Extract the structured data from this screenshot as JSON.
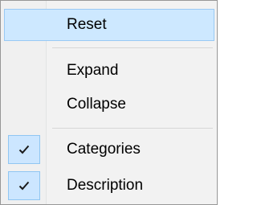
{
  "menu": {
    "items": [
      {
        "label": "Reset",
        "highlighted": true
      },
      {
        "label": "Expand"
      },
      {
        "label": "Collapse"
      },
      {
        "label": "Categories",
        "checked": true
      },
      {
        "label": "Description",
        "checked": true
      }
    ]
  },
  "colors": {
    "highlight_bg": "#cde8ff",
    "highlight_border": "#99c9f4",
    "menu_bg": "#f2f2f2",
    "check_bg": "#cce6ff"
  },
  "icons": {
    "check": "checkmark-icon"
  }
}
